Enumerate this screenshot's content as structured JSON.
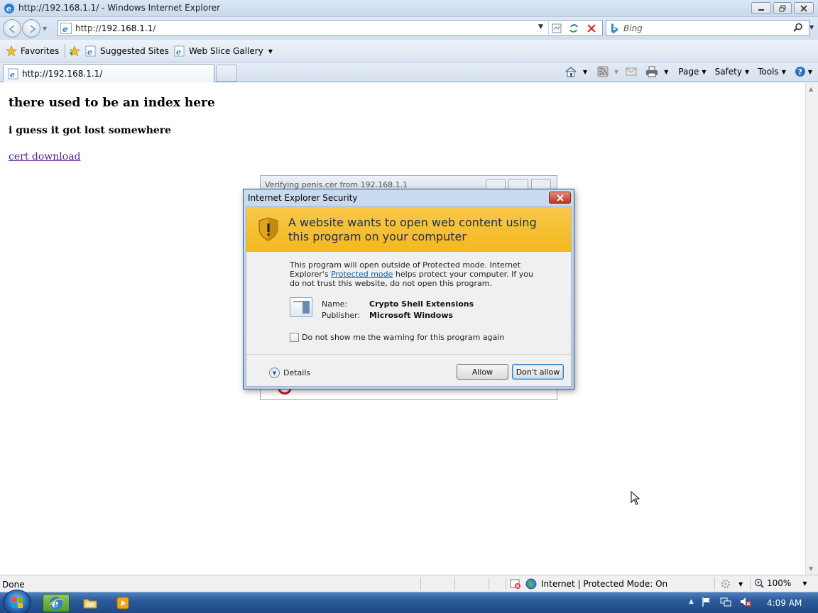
{
  "window": {
    "title": "http://192.168.1.1/ - Windows Internet Explorer"
  },
  "address_bar": {
    "url_prefix": "http://",
    "url_host": "192.168.1.1",
    "url_suffix": "/"
  },
  "search": {
    "placeholder": "Bing"
  },
  "favorites_bar": {
    "favorites_label": "Favorites",
    "items": [
      {
        "label": "Suggested Sites"
      },
      {
        "label": "Web Slice Gallery"
      }
    ]
  },
  "tabs": [
    {
      "label": "http://192.168.1.1/"
    }
  ],
  "command_bar": {
    "page_label": "Page",
    "safety_label": "Safety",
    "tools_label": "Tools"
  },
  "page": {
    "heading": "there used to be an index here",
    "subheading": "i guess it got lost somewhere",
    "link_text": "cert download"
  },
  "bg_dialog": {
    "title": "Verifying penis.cer from 192.168.1.1"
  },
  "security_dialog": {
    "title": "Internet Explorer Security",
    "banner": "A website wants to open web content using this program on your computer",
    "desc_before_link": "This program will open outside of Protected mode. Internet Explorer's ",
    "desc_link": "Protected mode",
    "desc_after_link": " helps protect your computer. If you do not trust this website, do not open this program.",
    "name_label": "Name:",
    "name_value": "Crypto Shell Extensions",
    "publisher_label": "Publisher:",
    "publisher_value": "Microsoft Windows",
    "checkbox_label": "Do not show me the warning for this program again",
    "details_label": "Details",
    "allow_label": "Allow",
    "deny_label": "Don't allow"
  },
  "status_bar": {
    "status": "Done",
    "zone": "Internet | Protected Mode: On",
    "zoom": "100%"
  },
  "taskbar": {
    "clock": "4:09 AM"
  }
}
